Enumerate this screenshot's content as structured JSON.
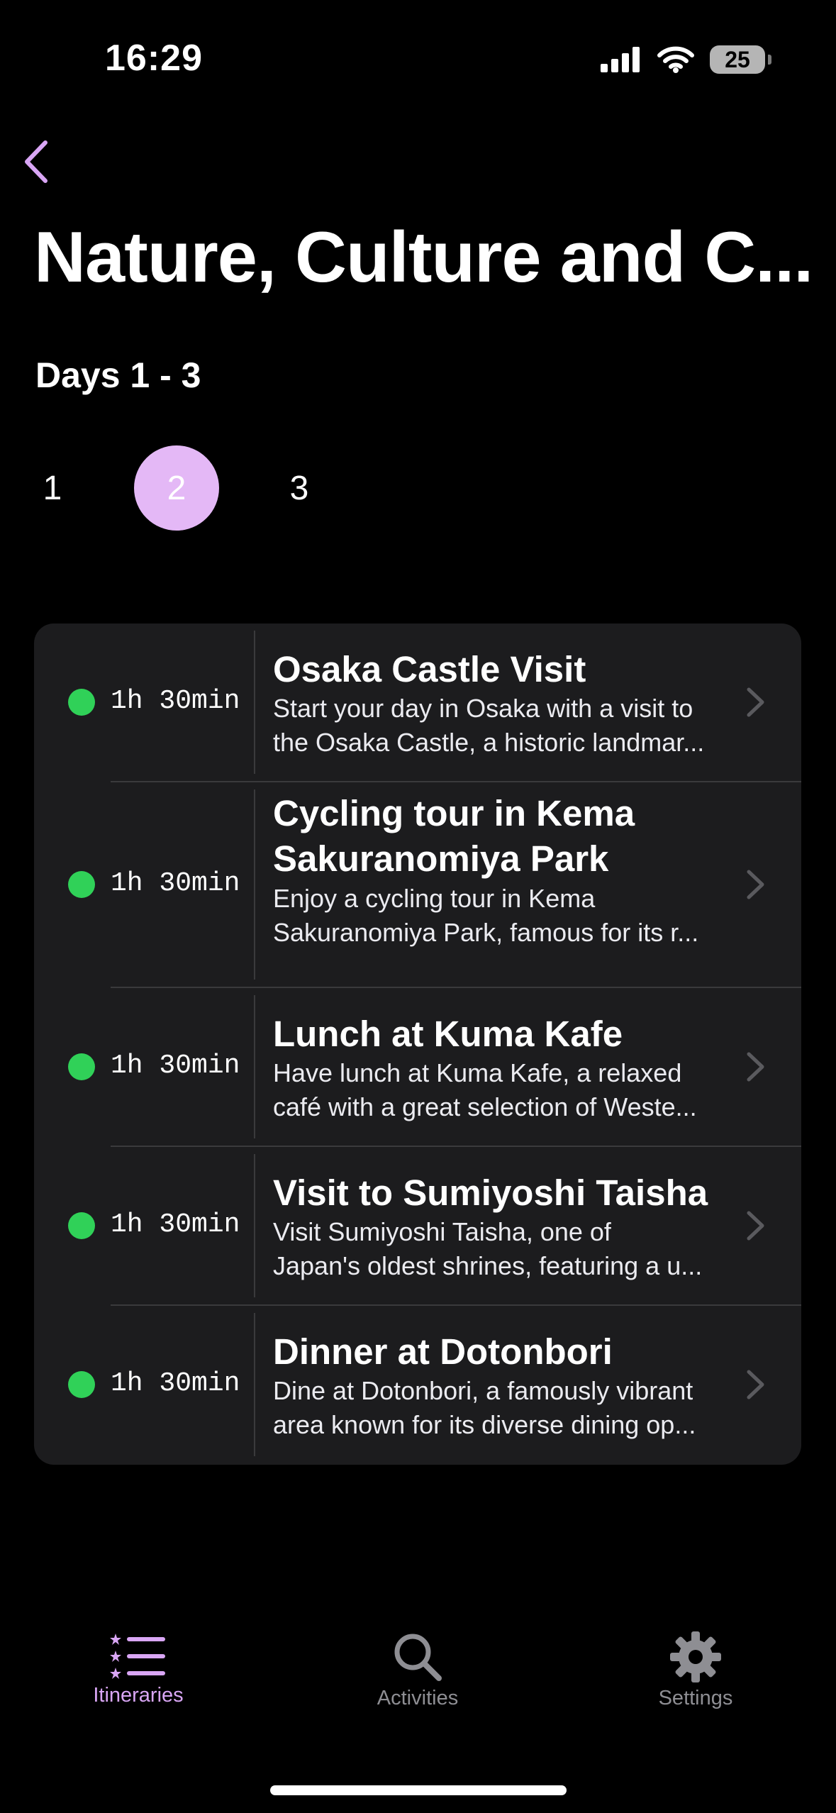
{
  "status_bar": {
    "time": "16:29",
    "battery_level": "25"
  },
  "header": {
    "title": "Nature, Culture and C...",
    "days_label": "Days 1 - 3"
  },
  "day_tabs": [
    {
      "label": "1",
      "selected": false
    },
    {
      "label": "2",
      "selected": true
    },
    {
      "label": "3",
      "selected": false
    }
  ],
  "activities": [
    {
      "duration": "1h 30min",
      "name": "Osaka Castle Visit",
      "description_lines": [
        "Start your day in Osaka with a visit to",
        "the Osaka Castle, a historic landmar..."
      ]
    },
    {
      "duration": "1h 30min",
      "name_lines": [
        "Cycling tour in Kema",
        "Sakuranomiya Park"
      ],
      "description_lines": [
        "Enjoy a cycling tour in Kema",
        "Sakuranomiya Park, famous for its r..."
      ]
    },
    {
      "duration": "1h 30min",
      "name": "Lunch at Kuma Kafe",
      "description_lines": [
        "Have lunch at Kuma Kafe, a relaxed",
        "café with a great selection of Weste..."
      ]
    },
    {
      "duration": "1h 30min",
      "name": "Visit to Sumiyoshi Taisha",
      "description_lines": [
        "Visit Sumiyoshi Taisha, one of",
        "Japan's oldest shrines, featuring a u..."
      ]
    },
    {
      "duration": "1h 30min",
      "name": "Dinner at Dotonbori",
      "description_lines": [
        "Dine at Dotonbori, a famously vibrant",
        "area known for its diverse dining op..."
      ]
    }
  ],
  "tab_bar": [
    {
      "label": "Itineraries",
      "icon": "list-icon",
      "active": true
    },
    {
      "label": "Activities",
      "icon": "search-icon",
      "active": false
    },
    {
      "label": "Settings",
      "icon": "gear-icon",
      "active": false
    }
  ],
  "colors": {
    "accent": "#e4b8f6",
    "tab_active": "#d9a6f5",
    "tab_inactive": "#8e8e93",
    "status_dot": "#30d158",
    "card_background": "#1c1c1e"
  }
}
